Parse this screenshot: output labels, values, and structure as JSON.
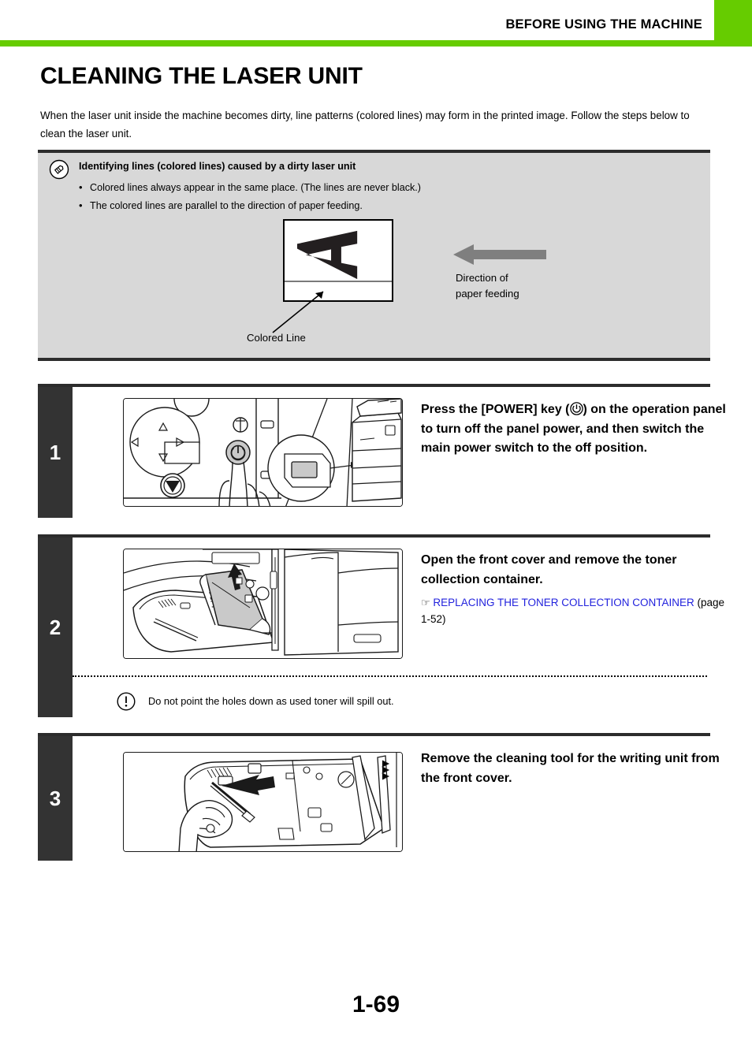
{
  "header": {
    "title": "BEFORE USING THE MACHINE",
    "accent_color": "#66cc00"
  },
  "page": {
    "title": "CLEANING THE LASER UNIT",
    "intro": "When the laser unit inside the machine becomes dirty, line patterns (colored lines) may form in the printed image. Follow the steps below to clean the laser unit.",
    "page_number": "1-69"
  },
  "note": {
    "icon": "pencil-note-icon",
    "heading": "Identifying lines (colored lines) caused by a dirty laser unit",
    "bullets": [
      "Colored lines always appear in the same place. (The lines are never black.)",
      "The colored lines are parallel to the direction of paper feeding."
    ],
    "figure": {
      "direction_label_line1": "Direction of",
      "direction_label_line2": "paper  feeding",
      "colored_line_label": "Colored Line",
      "background_color": "#d8d8d8",
      "arrow_color": "#7a7a7a"
    }
  },
  "steps": [
    {
      "number": "1",
      "text_prefix": "Press the [POWER] key (",
      "text_suffix": ") on the operation panel to turn off the panel power, and then switch the main power switch to the off position.",
      "icon": "power-icon",
      "figure_name": "operation-panel-power-key-illustration"
    },
    {
      "number": "2",
      "text": "Open the front cover and remove the toner collection container.",
      "link_hand": "☞",
      "link_text": "REPLACING THE TONER COLLECTION CONTAINER",
      "link_page": " (page 1-52)",
      "link_color": "#2222dd",
      "figure_name": "front-cover-toner-container-illustration",
      "caution": {
        "icon": "caution-exclamation-icon",
        "text": "Do not point the holes down as used toner will spill out."
      }
    },
    {
      "number": "3",
      "text": "Remove the cleaning tool for the writing unit from the front cover.",
      "figure_name": "cleaning-tool-removal-illustration"
    }
  ]
}
